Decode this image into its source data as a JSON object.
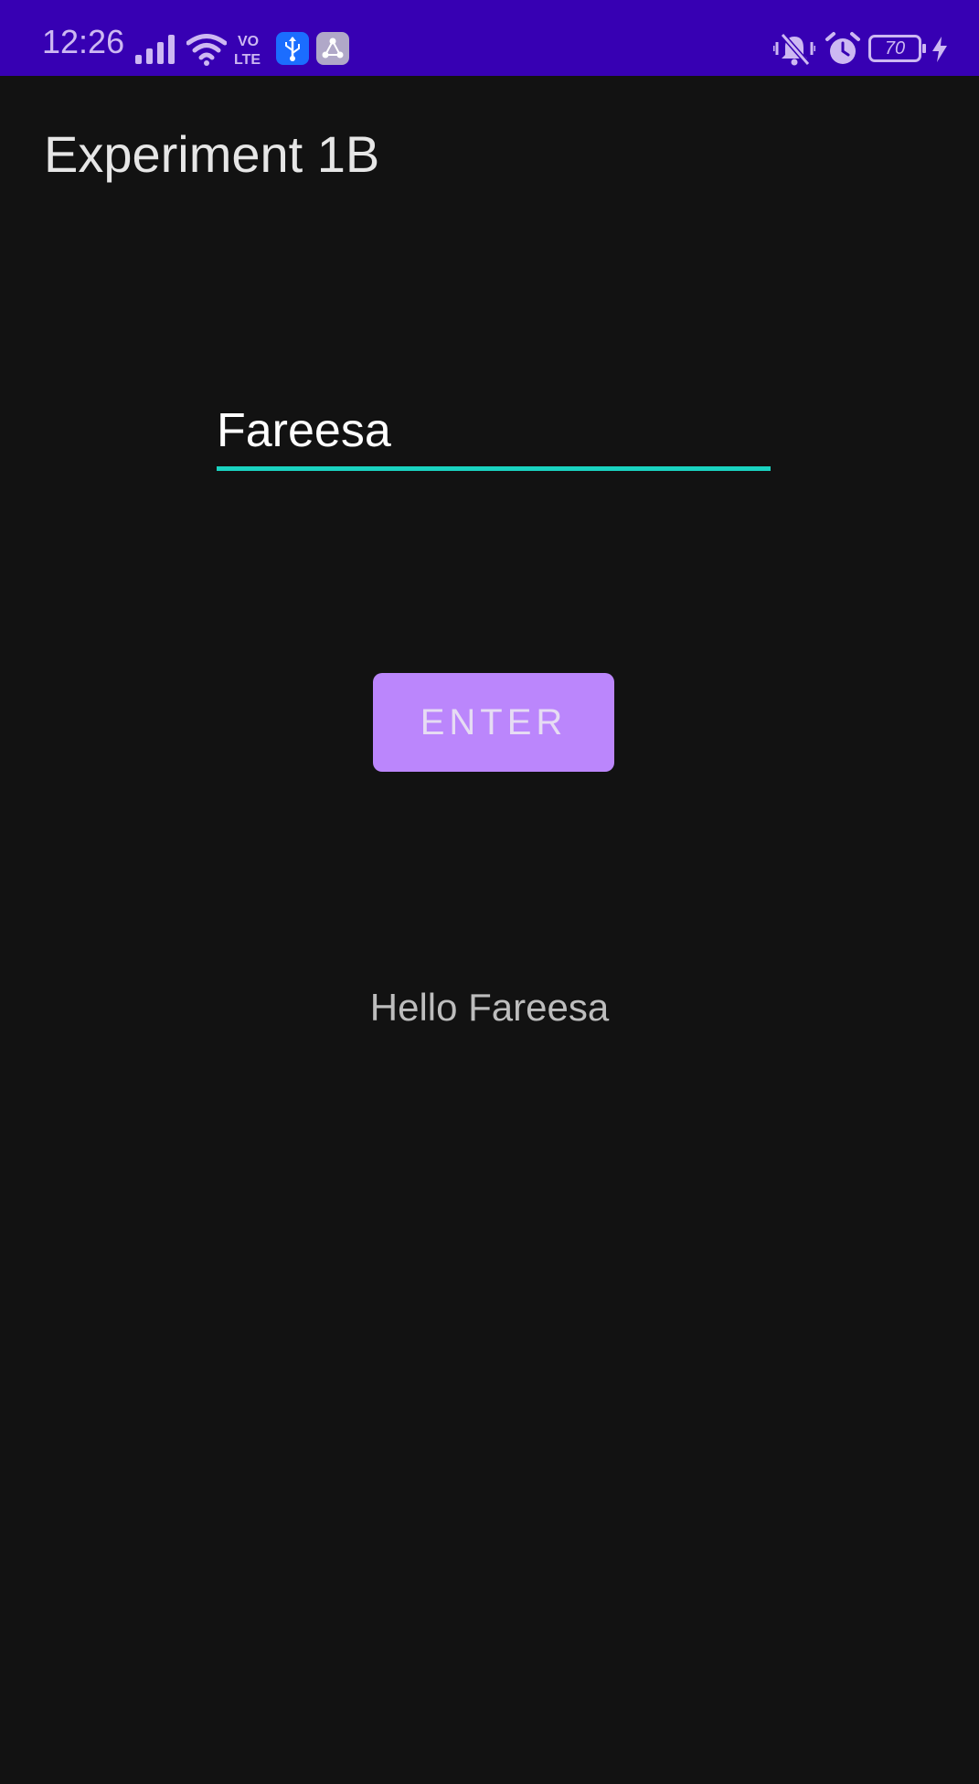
{
  "status_bar": {
    "time": "12:26",
    "network_type": "VO LTE",
    "battery_level": "70",
    "icons": [
      "signal-icon",
      "wifi-icon",
      "volte-icon",
      "usb-icon",
      "app-notification-icon",
      "vibrate-off-icon",
      "alarm-icon",
      "battery-icon",
      "charging-icon"
    ],
    "background_color": "#3700b3"
  },
  "app": {
    "title": "Experiment 1B"
  },
  "form": {
    "name_value": "Fareesa",
    "enter_label": "ENTER",
    "underline_color": "#1ad3c1",
    "button_color": "#bb86fc"
  },
  "output": {
    "greeting": "Hello Fareesa"
  }
}
